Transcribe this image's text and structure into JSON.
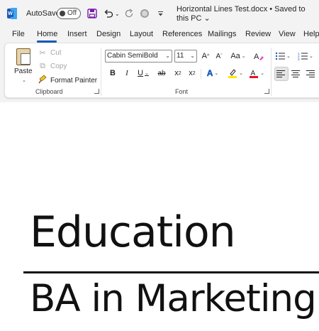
{
  "titlebar": {
    "autosave_label": "AutoSave",
    "autosave_state": "Off",
    "doc_title": "Horizontal Lines Test.docx • Saved to this PC ⌄"
  },
  "tabs": [
    "File",
    "Home",
    "Insert",
    "Design",
    "Layout",
    "References",
    "Mailings",
    "Review",
    "View",
    "Help"
  ],
  "active_tab": "Home",
  "clipboard": {
    "paste_label": "Paste",
    "cut_label": "Cut",
    "copy_label": "Copy",
    "format_painter_label": "Format Painter",
    "group_label": "Clipboard"
  },
  "font": {
    "font_name": "Cabin SemiBold",
    "font_size": "11",
    "group_label": "Font"
  },
  "document": {
    "heading": "Education",
    "subheading": "BA in Marketing"
  },
  "colors": {
    "accent": "#185abd",
    "highlight": "#ffe600",
    "font_color": "#e81123"
  }
}
